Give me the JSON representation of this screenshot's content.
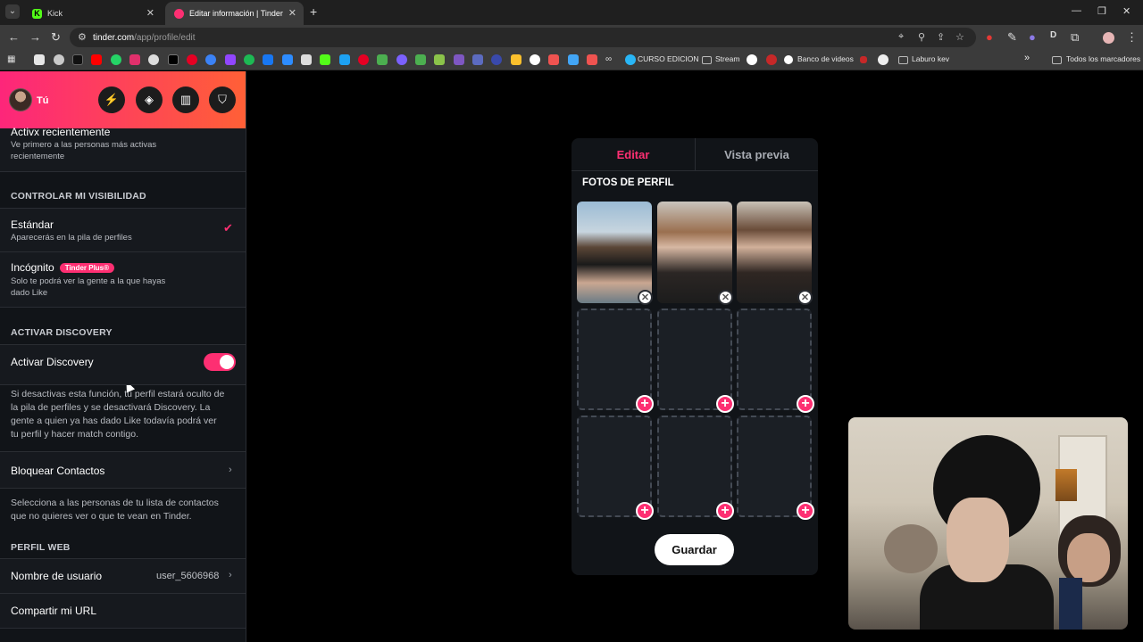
{
  "browser": {
    "tabs": [
      {
        "title": "Kick",
        "active": false,
        "favicon_color": "#53fc18"
      },
      {
        "title": "Editar información | Tinder",
        "active": true,
        "favicon_color": "#fd2f72"
      }
    ],
    "url_host": "tinder.com",
    "url_path": "/app/profile/edit",
    "bookmarks": [
      "CURSO EDICION",
      "Stream",
      "Banco de videos",
      "Laburo kev",
      "Todos los marcadores"
    ]
  },
  "sidebar": {
    "user_name": "Tú",
    "header_buttons": [
      "boost-icon",
      "explore-icon",
      "gifts-icon",
      "shield-icon"
    ],
    "recent_active": {
      "title": "Activx recientemente",
      "subtitle_line1": "Ve primero a las personas más activas",
      "subtitle_line2": "recientemente"
    },
    "visibility_section": "CONTROLAR MI VISIBILIDAD",
    "standard": {
      "title": "Estándar",
      "subtitle": "Aparecerás en la pila de perfiles",
      "selected": true
    },
    "incognito": {
      "title": "Incógnito",
      "badge": "Tinder Plus®",
      "subtitle_line1": "Solo te podrá ver la gente a la que hayas",
      "subtitle_line2": "dado Like"
    },
    "discovery_section": "ACTIVAR DISCOVERY",
    "discovery": {
      "title": "Activar Discovery",
      "enabled": true,
      "description_line1": "Si desactivas esta función, tu perfil estará oculto de",
      "description_line2": "la pila de perfiles y se desactivará Discovery. La",
      "description_line3": "gente a quien ya has dado Like todavía podrá ver",
      "description_line4": "tu perfil y hacer match contigo."
    },
    "block_contacts": {
      "title": "Bloquear Contactos",
      "description_line1": "Selecciona a las personas de tu lista de contactos",
      "description_line2": "que no quieres ver o que te vean en Tinder."
    },
    "web_profile_section": "PERFIL WEB",
    "username": {
      "label": "Nombre de usuario",
      "value": "user_5606968"
    },
    "share_url": "Compartir mi URL"
  },
  "editor": {
    "tab_edit": "Editar",
    "tab_preview": "Vista previa",
    "photos_title": "FOTOS DE PERFIL",
    "photos_filled": 3,
    "photos_total": 9,
    "save_label": "Guardar"
  },
  "colors": {
    "accent": "#fd2f72",
    "gradient_start": "#fd267a",
    "gradient_end": "#ff6036",
    "panel_bg": "#111418"
  }
}
